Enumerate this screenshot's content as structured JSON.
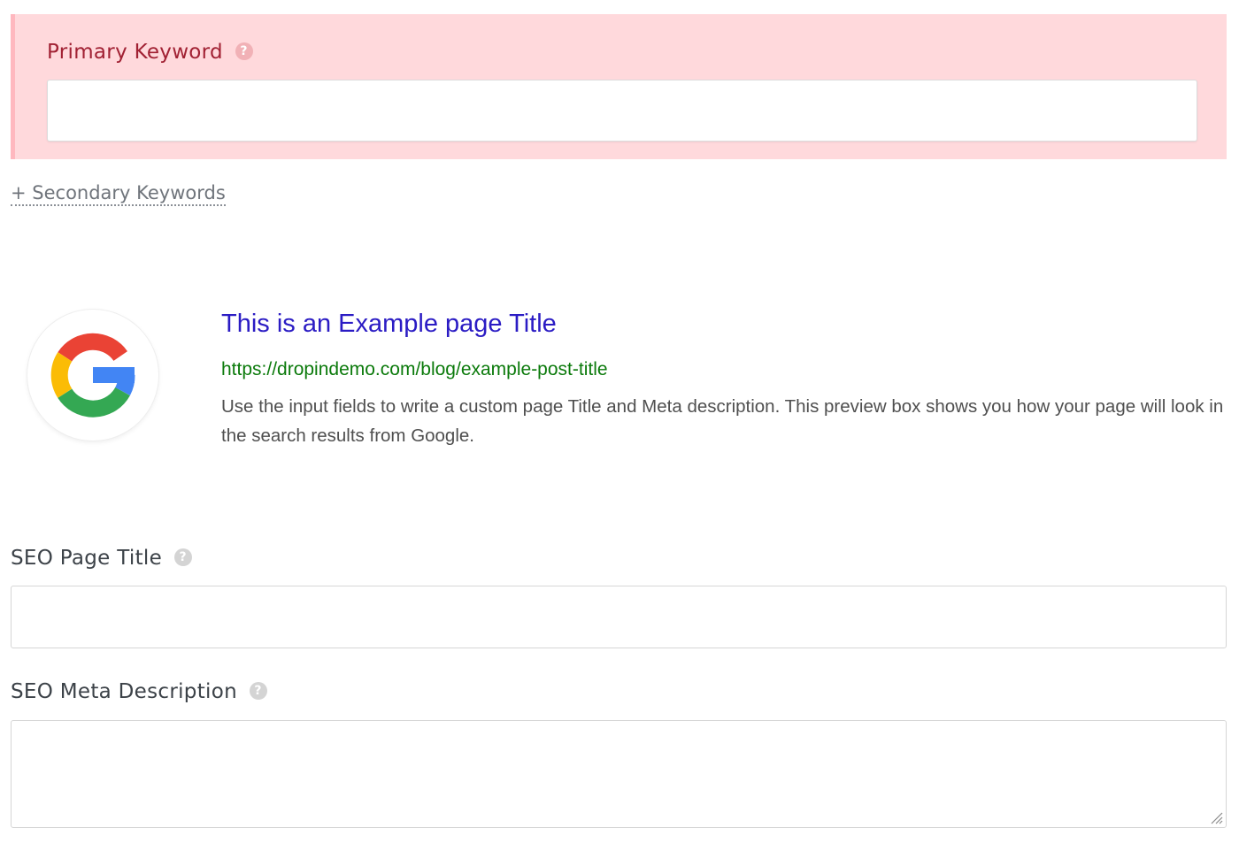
{
  "primary_keyword": {
    "label": "Primary Keyword",
    "help_icon": "question-icon",
    "value": "",
    "placeholder": "",
    "panel_background": "#ffd9dc",
    "label_color": "#a12133"
  },
  "secondary_keywords": {
    "link_label": "+ Secondary Keywords"
  },
  "google_preview": {
    "logo_icon": "google-logo-icon",
    "title": "This is an Example page Title",
    "url": "https://dropindemo.com/blog/example-post-title",
    "description": "Use the input fields to write a custom page Title and Meta description. This preview box shows you how your page will look in the search results from Google.",
    "title_color": "#2b1cc4",
    "url_color": "#0b7a0b"
  },
  "seo_title": {
    "label": "SEO Page Title",
    "help_icon": "question-icon",
    "value": "",
    "placeholder": ""
  },
  "seo_meta": {
    "label": "SEO Meta Description",
    "help_icon": "question-icon",
    "value": "",
    "placeholder": ""
  }
}
